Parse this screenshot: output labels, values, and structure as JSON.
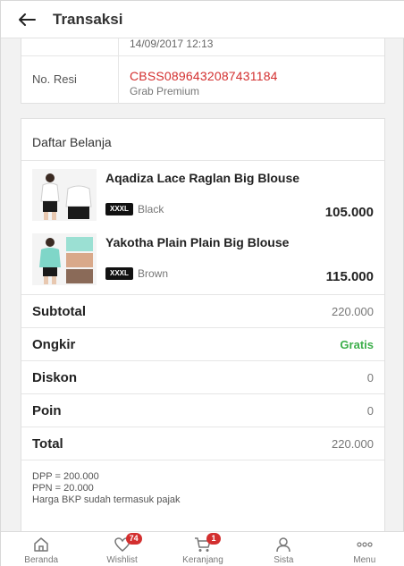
{
  "header": {
    "title": "Transaksi"
  },
  "info": {
    "time_value": "14/09/2017 12:13",
    "resi_label": "No. Resi",
    "resi_number": "CBSS0896432087431184",
    "courier": "Grab Premium"
  },
  "belanja": {
    "title": "Daftar Belanja",
    "items": [
      {
        "name": "Aqadiza Lace Raglan Big Blouse",
        "size": "XXXL",
        "variant": "Black",
        "price": "105.000"
      },
      {
        "name": "Yakotha Plain Plain Big Blouse",
        "size": "XXXL",
        "variant": "Brown",
        "price": "115.000"
      }
    ],
    "summary": {
      "subtotal_label": "Subtotal",
      "subtotal_value": "220.000",
      "ongkir_label": "Ongkir",
      "ongkir_value": "Gratis",
      "diskon_label": "Diskon",
      "diskon_value": "0",
      "poin_label": "Poin",
      "poin_value": "0",
      "total_label": "Total",
      "total_value": "220.000"
    },
    "tax": {
      "dpp": "DPP = 200.000",
      "ppn": "PPN = 20.000",
      "note": "Harga BKP sudah termasuk pajak"
    }
  },
  "nav": {
    "items": [
      {
        "label": "Beranda",
        "icon": "home-icon"
      },
      {
        "label": "Wishlist",
        "icon": "heart-icon",
        "badge": "74"
      },
      {
        "label": "Keranjang",
        "icon": "cart-icon",
        "badge": "1"
      },
      {
        "label": "Sista",
        "icon": "person-icon"
      },
      {
        "label": "Menu",
        "icon": "more-icon"
      }
    ]
  },
  "colors": {
    "accent_red": "#d32f2f",
    "free_green": "#3cae4a"
  }
}
